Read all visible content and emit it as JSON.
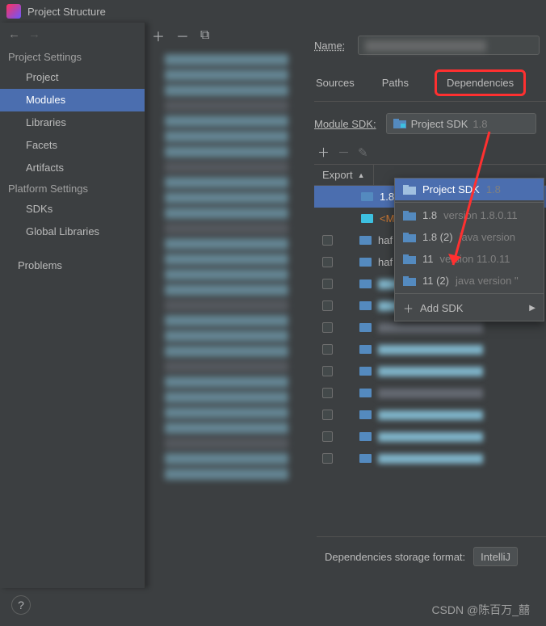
{
  "window": {
    "title": "Project Structure"
  },
  "sidebar": {
    "nav_back": "←",
    "nav_fwd": "→",
    "sections": {
      "project_settings": "Project Settings",
      "platform_settings": "Platform Settings"
    },
    "items": {
      "project": "Project",
      "modules": "Modules",
      "libraries": "Libraries",
      "facets": "Facets",
      "artifacts": "Artifacts",
      "sdks": "SDKs",
      "global_libraries": "Global Libraries",
      "problems": "Problems"
    }
  },
  "module_toolbar": {
    "add": "＋",
    "remove": "－",
    "copy": "⧉"
  },
  "right": {
    "name_label": "Name:",
    "tabs": {
      "sources": "Sources",
      "paths": "Paths",
      "dependencies": "Dependencies"
    },
    "module_sdk_label": "Module SDK:",
    "module_sdk_value": "Project SDK ",
    "module_sdk_grey": "1.8",
    "dep_toolbar": {
      "add": "＋",
      "remove": "－",
      "edit": "✎"
    },
    "export_label": "Export",
    "rows": {
      "r0_label": "1.8",
      "r1_label": "<M",
      "r2_label": "haf",
      "r3_label": "haf"
    },
    "storage_label": "Dependencies storage format:",
    "storage_value": "IntelliJ"
  },
  "dropdown": {
    "item0": {
      "main": "Project SDK ",
      "grey": "1.8"
    },
    "item1": {
      "main": "1.8 ",
      "grey": "version 1.8.0.11"
    },
    "item2": {
      "main": "1.8 (2) ",
      "grey": "java version"
    },
    "item3": {
      "main": "11 ",
      "grey": "version 11.0.11"
    },
    "item4": {
      "main": "11 (2) ",
      "grey": "java version \""
    },
    "add": "Add SDK"
  },
  "help": "?",
  "watermark": "CSDN @陈百万_囍"
}
